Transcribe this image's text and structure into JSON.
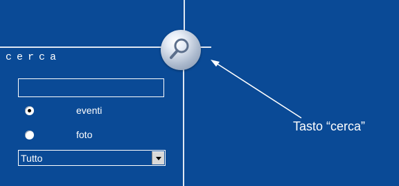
{
  "search_panel": {
    "title": "cerca",
    "query_value": "",
    "options": [
      {
        "label": "eventi",
        "selected": true
      },
      {
        "label": "foto",
        "selected": false
      }
    ],
    "category_select": {
      "selected": "Tutto"
    }
  },
  "search_button": {
    "icon": "magnifier-icon"
  },
  "annotation": {
    "label": "Tasto “cerca”"
  },
  "colors": {
    "background": "#0a4a96",
    "lines": "#dfe7f2",
    "text": "#ffffff"
  }
}
